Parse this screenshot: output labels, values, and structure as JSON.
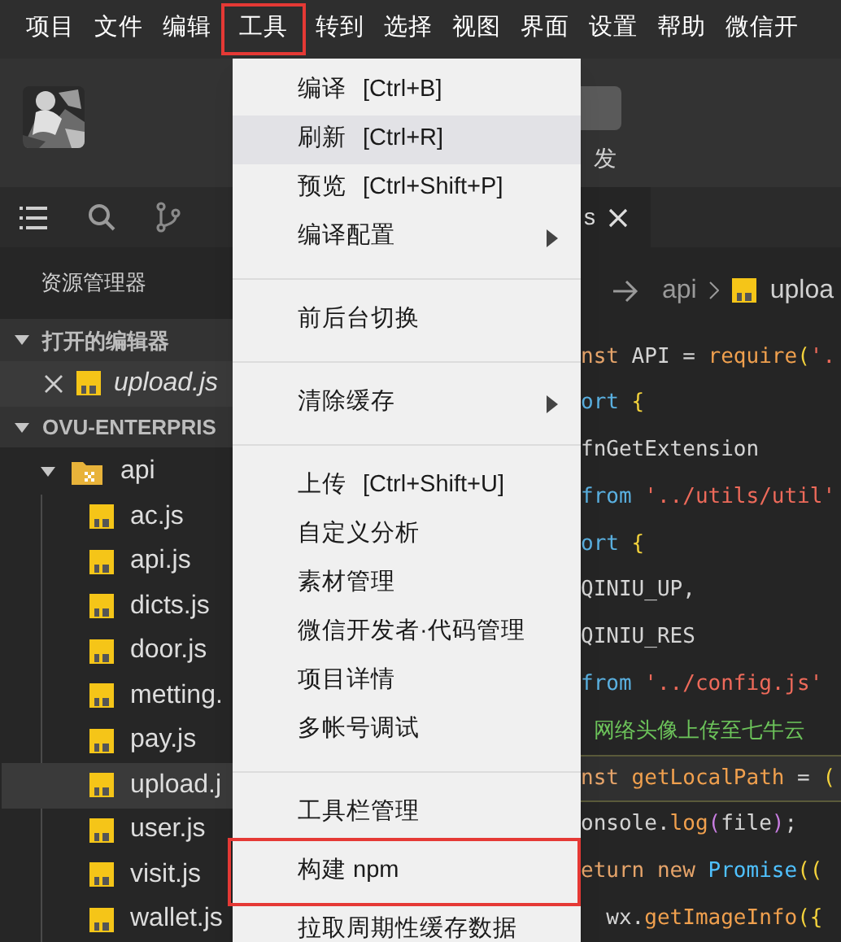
{
  "menubar": [
    {
      "label": "项目",
      "annotated": false
    },
    {
      "label": "文件",
      "annotated": false
    },
    {
      "label": "编辑",
      "annotated": false
    },
    {
      "label": "工具",
      "annotated": true
    },
    {
      "label": "转到",
      "annotated": false
    },
    {
      "label": "选择",
      "annotated": false
    },
    {
      "label": "视图",
      "annotated": false
    },
    {
      "label": "界面",
      "annotated": false
    },
    {
      "label": "设置",
      "annotated": false
    },
    {
      "label": "帮助",
      "annotated": false
    },
    {
      "label": "微信开",
      "annotated": false
    }
  ],
  "toolbar": {
    "caption": "发"
  },
  "editor_tab": {
    "label": "s"
  },
  "sidebar": {
    "title": "资源管理器",
    "open_editors": {
      "title": "打开的编辑器",
      "expanded": true,
      "files": [
        {
          "name": "upload.js",
          "selected": true
        }
      ]
    },
    "project": {
      "title": "OVU-ENTERPRIS",
      "expanded": true,
      "folders": [
        {
          "name": "api",
          "expanded": true,
          "files": [
            {
              "name": "ac.js",
              "selected": false
            },
            {
              "name": "api.js",
              "selected": false
            },
            {
              "name": "dicts.js",
              "selected": false
            },
            {
              "name": "door.js",
              "selected": false
            },
            {
              "name": "metting.",
              "selected": false
            },
            {
              "name": "pay.js",
              "selected": false
            },
            {
              "name": "upload.j",
              "selected": true
            },
            {
              "name": "user.js",
              "selected": false
            },
            {
              "name": "visit.js",
              "selected": false
            },
            {
              "name": "wallet.js",
              "selected": false
            }
          ]
        }
      ]
    }
  },
  "breadcrumb": {
    "folder": "api",
    "file": "uploa"
  },
  "code": [
    {
      "highlighted": false,
      "tokens": [
        {
          "text": "nst",
          "kind": "keyword"
        },
        {
          "text": " API = ",
          "kind": "plain"
        },
        {
          "text": "require",
          "kind": "func"
        },
        {
          "text": "(",
          "kind": "bracket"
        },
        {
          "text": "'.",
          "kind": "string"
        }
      ]
    },
    {
      "highlighted": false,
      "tokens": [
        {
          "text": "ort",
          "kind": "module"
        },
        {
          "text": " {",
          "kind": "bracket"
        }
      ]
    },
    {
      "highlighted": false,
      "tokens": [
        {
          "text": "fnGetExtension",
          "kind": "plain"
        }
      ]
    },
    {
      "highlighted": false,
      "tokens": [
        {
          "text": "from",
          "kind": "module"
        },
        {
          "text": " '../utils/util'",
          "kind": "string"
        }
      ]
    },
    {
      "highlighted": false,
      "tokens": [
        {
          "text": "ort",
          "kind": "module"
        },
        {
          "text": " {",
          "kind": "bracket"
        }
      ]
    },
    {
      "highlighted": false,
      "tokens": [
        {
          "text": "QINIU_UP,",
          "kind": "plain"
        }
      ]
    },
    {
      "highlighted": false,
      "tokens": [
        {
          "text": "QINIU_RES",
          "kind": "plain"
        }
      ]
    },
    {
      "highlighted": false,
      "tokens": [
        {
          "text": "from",
          "kind": "module"
        },
        {
          "text": " '../config.js'",
          "kind": "string"
        }
      ]
    },
    {
      "highlighted": false,
      "tokens": [
        {
          "text": " 网络头像上传至七牛云",
          "kind": "comment"
        }
      ]
    },
    {
      "highlighted": true,
      "tokens": [
        {
          "text": "nst",
          "kind": "keyword"
        },
        {
          "text": " getLocalPath",
          "kind": "func"
        },
        {
          "text": " = ",
          "kind": "plain"
        },
        {
          "text": "(",
          "kind": "bracket"
        }
      ]
    },
    {
      "highlighted": false,
      "tokens": [
        {
          "text": "onsole.",
          "kind": "plain"
        },
        {
          "text": "log",
          "kind": "func"
        },
        {
          "text": "(",
          "kind": "bracket2"
        },
        {
          "text": "file",
          "kind": "plain"
        },
        {
          "text": ")",
          "kind": "bracket2"
        },
        {
          "text": ";",
          "kind": "plain"
        }
      ]
    },
    {
      "highlighted": false,
      "tokens": [
        {
          "text": "eturn",
          "kind": "keyword"
        },
        {
          "text": " new ",
          "kind": "keyword"
        },
        {
          "text": "Promise",
          "kind": "type"
        },
        {
          "text": "((",
          "kind": "bracket"
        }
      ]
    },
    {
      "highlighted": false,
      "tokens": [
        {
          "text": "  wx.",
          "kind": "plain"
        },
        {
          "text": "getImageInfo",
          "kind": "func"
        },
        {
          "text": "({",
          "kind": "bracket"
        }
      ]
    }
  ],
  "menu": {
    "items": [
      {
        "kind": "item",
        "label": "编译",
        "shortcut": "[Ctrl+B]",
        "submenu": false,
        "hovered": false,
        "annotated": false
      },
      {
        "kind": "item",
        "label": "刷新",
        "shortcut": "[Ctrl+R]",
        "submenu": false,
        "hovered": true,
        "annotated": false
      },
      {
        "kind": "item",
        "label": "预览",
        "shortcut": "[Ctrl+Shift+P]",
        "submenu": false,
        "hovered": false,
        "annotated": false
      },
      {
        "kind": "item",
        "label": "编译配置",
        "submenu": true,
        "hovered": false,
        "annotated": false
      },
      {
        "kind": "separator"
      },
      {
        "kind": "item",
        "label": "前后台切换",
        "submenu": false,
        "hovered": false,
        "annotated": false
      },
      {
        "kind": "separator"
      },
      {
        "kind": "item",
        "label": "清除缓存",
        "submenu": true,
        "hovered": false,
        "annotated": false
      },
      {
        "kind": "separator"
      },
      {
        "kind": "item",
        "label": "上传",
        "shortcut": "[Ctrl+Shift+U]",
        "submenu": false,
        "hovered": false,
        "annotated": false
      },
      {
        "kind": "item",
        "label": "自定义分析",
        "submenu": false,
        "hovered": false,
        "annotated": false
      },
      {
        "kind": "item",
        "label": "素材管理",
        "submenu": false,
        "hovered": false,
        "annotated": false
      },
      {
        "kind": "item",
        "label": "微信开发者·代码管理",
        "submenu": false,
        "hovered": false,
        "annotated": false
      },
      {
        "kind": "item",
        "label": "项目详情",
        "submenu": false,
        "hovered": false,
        "annotated": false
      },
      {
        "kind": "item",
        "label": "多帐号调试",
        "submenu": false,
        "hovered": false,
        "annotated": false
      },
      {
        "kind": "separator"
      },
      {
        "kind": "item",
        "label": "工具栏管理",
        "submenu": false,
        "hovered": false,
        "annotated": false
      },
      {
        "kind": "item",
        "label": "构建 npm",
        "submenu": false,
        "hovered": false,
        "annotated": true
      },
      {
        "kind": "item",
        "label": "拉取周期性缓存数据",
        "submenu": false,
        "hovered": false,
        "annotated": false
      }
    ]
  }
}
